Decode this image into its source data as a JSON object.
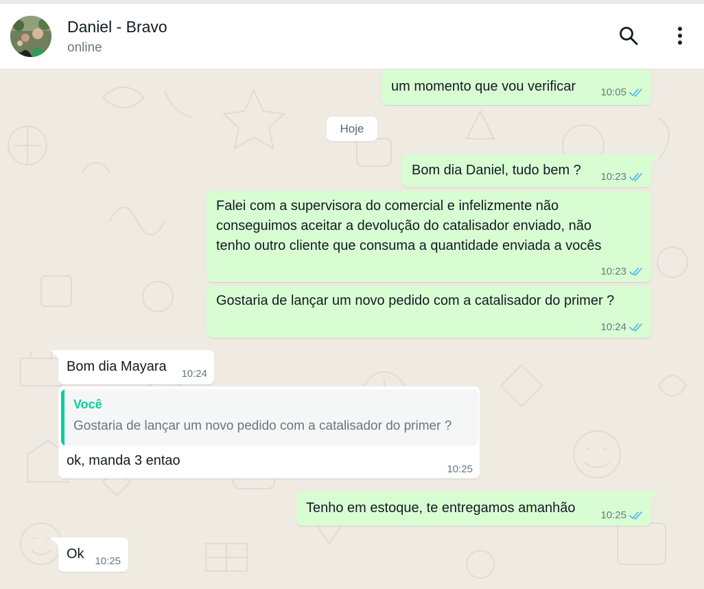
{
  "header": {
    "contact_name": "Daniel - Bravo",
    "status": "online",
    "search_icon": "search-icon",
    "menu_icon": "more-vertical-icon"
  },
  "chat": {
    "date_divider": "Hoje",
    "messages": [
      {
        "direction": "out",
        "text": "um momento que vou verificar",
        "time": "10:05",
        "status": "read"
      },
      {
        "direction": "out",
        "text": "Bom dia Daniel, tudo bem ?",
        "time": "10:23",
        "status": "read"
      },
      {
        "direction": "out",
        "lines": [
          "Falei com a supervisora do comercial e infelizmente não",
          "conseguimos aceitar a devolução do catalisador enviado, não",
          "tenho outro cliente que consuma a quantidade enviada a vocês"
        ],
        "time": "10:23",
        "status": "read"
      },
      {
        "direction": "out",
        "text": "Gostaria de lançar um novo pedido com a catalisador do primer ?",
        "time": "10:24",
        "status": "read"
      },
      {
        "direction": "in",
        "text": "Bom dia Mayara",
        "time": "10:24"
      },
      {
        "direction": "in",
        "quote": {
          "author": "Você",
          "text": "Gostaria de lançar um novo pedido com a catalisador do primer ?"
        },
        "text": "ok, manda 3 entao",
        "time": "10:25"
      },
      {
        "direction": "out",
        "text": "Tenho em estoque, te entregamos amanhão",
        "time": "10:25",
        "status": "read"
      },
      {
        "direction": "in",
        "text": "Ok",
        "time": "10:25"
      }
    ]
  },
  "colors": {
    "outgoing_bubble": "#d9fdd3",
    "incoming_bubble": "#ffffff",
    "chat_background": "#efeae2",
    "read_ticks": "#53bdeb",
    "quote_accent": "#06cf9c"
  }
}
